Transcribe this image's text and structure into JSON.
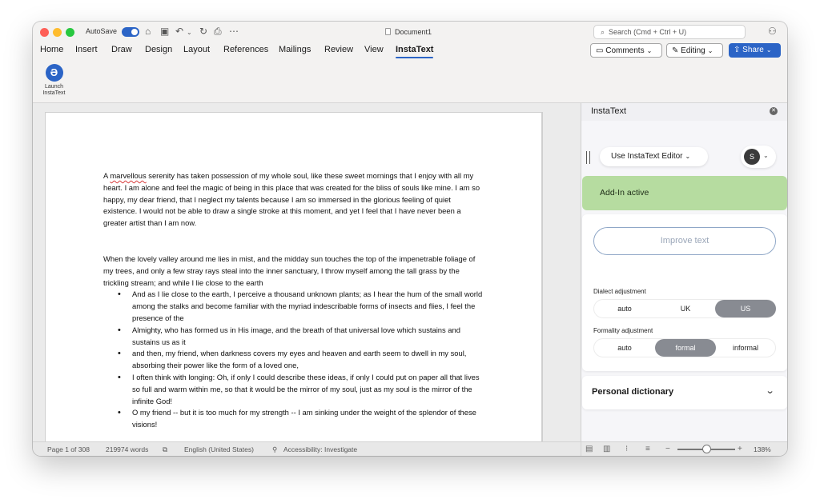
{
  "titlebar": {
    "autosave_label": "AutoSave",
    "document_title": "Document1",
    "search_placeholder": "Search (Cmd + Ctrl + U)"
  },
  "menu": {
    "tabs": [
      "Home",
      "Insert",
      "Draw",
      "Design",
      "Layout",
      "References",
      "Mailings",
      "Review",
      "View",
      "InstaText"
    ],
    "active_tab": "InstaText",
    "comments_label": "Comments",
    "editing_label": "Editing",
    "share_label": "Share"
  },
  "ribbon": {
    "launch_label_line1": "Launch",
    "launch_label_line2": "InstaText"
  },
  "document": {
    "paragraph1_first_word": "A ",
    "paragraph1_misspelled": "marvellous",
    "paragraph1_rest": " serenity has taken possession of my whole soul, like these sweet mornings that I enjoy with all my heart. I am alone and feel the magic of being in this place that was created for the bliss of souls like mine. I am so happy, my dear friend, that I neglect my talents because I am so immersed in the glorious feeling of quiet existence. I would not be able to draw a single stroke at this moment, and yet I feel that I have never been a greater artist than I am now.",
    "paragraph2": "When the lovely valley around me lies in mist, and the midday sun touches the top of the impenetrable foliage of my trees, and only a few stray rays steal into the inner sanctuary, I throw myself among the tall grass by the trickling stream; and while I lie close to the earth",
    "bullets": [
      "And as I lie close to the earth, I perceive a thousand unknown plants; as I hear the hum of the small world among the stalks and become familiar with the myriad indescribable forms of insects and flies, I feel the presence of the",
      "Almighty, who has formed us in His image, and the breath of that universal love which sustains and sustains us as it",
      " and then, my friend, when darkness covers my eyes and heaven and earth seem to dwell in my soul, absorbing their power like the form of a loved one,",
      "I often think with longing: Oh, if only I could describe these ideas, if only I could put on paper all that lives so full and warm within me, so that it would be the mirror of my soul, just as my soul is the mirror of the infinite God!",
      "O my friend -- but it is too much for my strength -- I am sinking under the weight of the splendor of these visions!"
    ]
  },
  "panel": {
    "title": "InstaText",
    "editor_button": "Use InstaText Editor",
    "avatar_initial": "S",
    "addin_status": "Add-In active",
    "improve_button": "Improve text",
    "dialect_label": "Dialect adjustment",
    "dialect_options": [
      "auto",
      "UK",
      "US"
    ],
    "dialect_selected": "US",
    "formality_label": "Formality adjustment",
    "formality_options": [
      "auto",
      "formal",
      "informal"
    ],
    "formality_selected": "formal",
    "dictionary_label": "Personal dictionary"
  },
  "statusbar": {
    "page": "Page 1 of 308",
    "words": "219974 words",
    "language": "English (United States)",
    "accessibility": "Accessibility: Investigate",
    "zoom": "138%"
  },
  "colors": {
    "accent": "#2b64c6",
    "addin_green": "#b6dca0",
    "segment_selected": "#888b92"
  }
}
